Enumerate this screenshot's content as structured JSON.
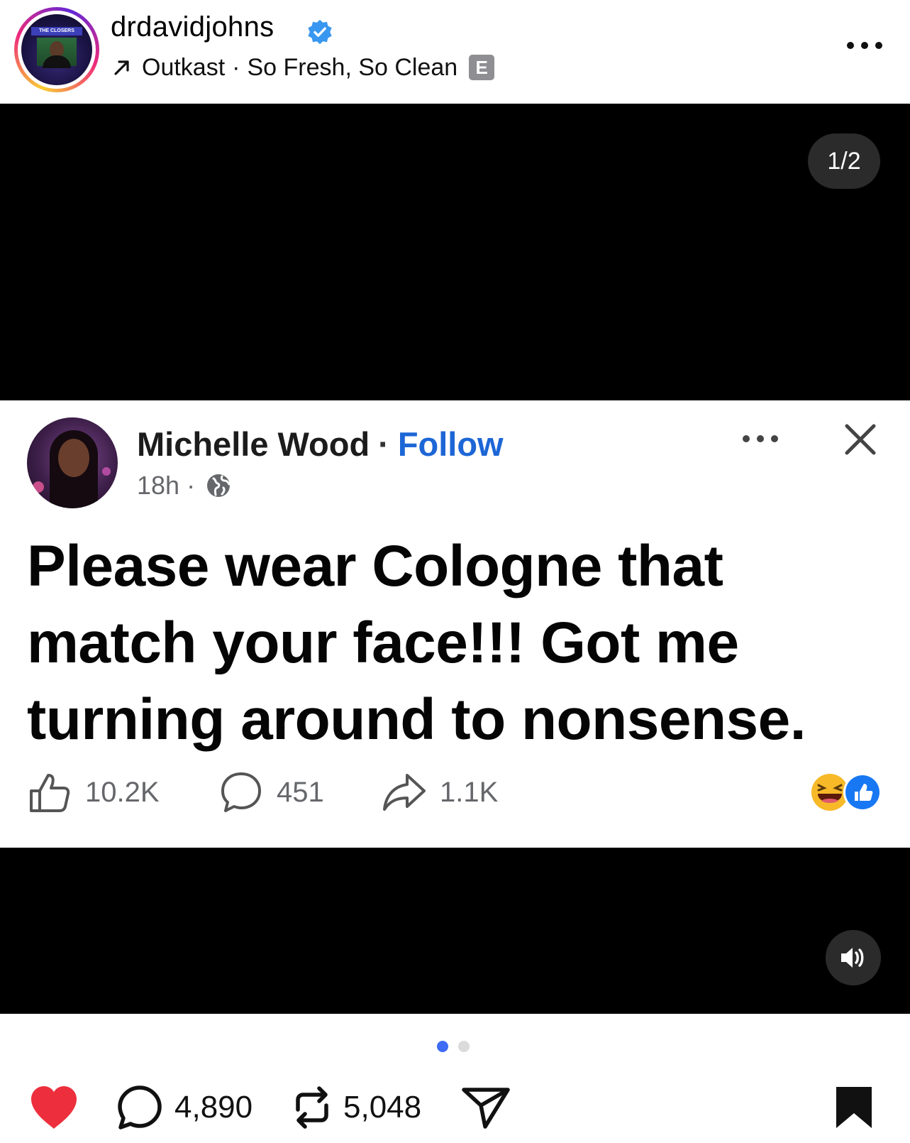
{
  "header": {
    "username": "drdavidjohns",
    "music_artist": "Outkast",
    "music_separator": "·",
    "music_title": "So Fresh, So Clean",
    "explicit_badge": "E",
    "avatar_banner": "THE CLOSERS",
    "verified_color": "#3897f0"
  },
  "media": {
    "page_counter": "1/2",
    "carousel": {
      "current": 1,
      "total": 2
    }
  },
  "fb_post": {
    "author": "Michelle Wood",
    "separator": "·",
    "follow_label": "Follow",
    "time": "18h",
    "time_separator": "·",
    "text": "Please wear Cologne that match your face!!! Got me turning around to nonsense.",
    "likes": "10.2K",
    "comments": "451",
    "shares": "1.1K",
    "follow_color": "#1d66d6"
  },
  "actions": {
    "likes": "",
    "comments": "4,890",
    "reposts": "5,048",
    "like_color": "#ed2f3d"
  },
  "icons": [
    "verified-icon",
    "arrow-up-right-icon",
    "more-icon",
    "globe-icon",
    "close-icon",
    "thumbs-up-icon",
    "comment-icon",
    "share-icon",
    "haha-reaction-icon",
    "like-reaction-icon",
    "volume-icon",
    "heart-icon",
    "repost-icon",
    "send-icon",
    "bookmark-icon"
  ]
}
